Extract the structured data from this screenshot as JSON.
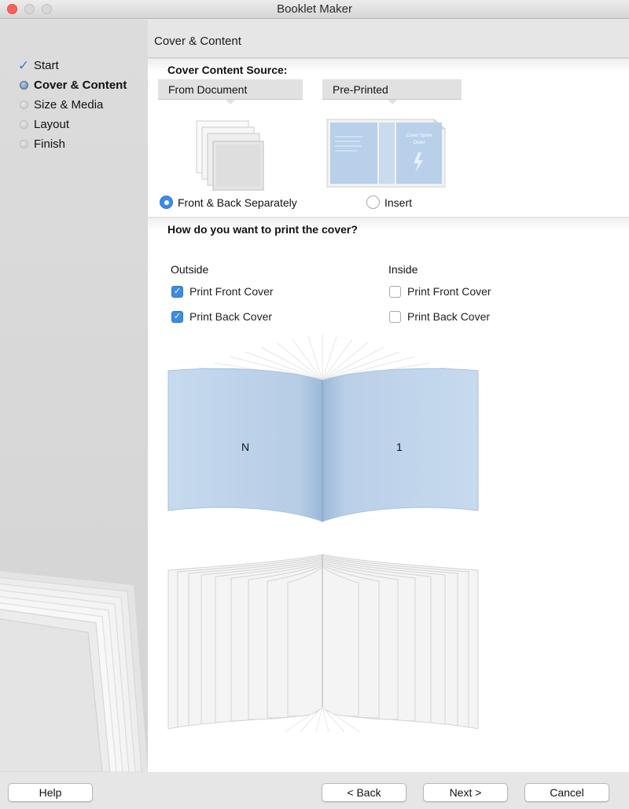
{
  "window": {
    "title": "Booklet Maker"
  },
  "sidebar": {
    "steps": [
      {
        "label": "Start",
        "state": "done"
      },
      {
        "label": "Cover & Content",
        "state": "current"
      },
      {
        "label": "Size & Media",
        "state": "pending"
      },
      {
        "label": "Layout",
        "state": "pending"
      },
      {
        "label": "Finish",
        "state": "pending"
      }
    ]
  },
  "header": {
    "title": "Cover & Content"
  },
  "cover_source": {
    "heading": "Cover Content Source:",
    "tabs": [
      "From Document",
      "Pre-Printed"
    ],
    "options": [
      {
        "label": "Front & Back Separately",
        "selected": true
      },
      {
        "label": "Insert",
        "selected": false
      }
    ],
    "preprinted_art_text": [
      "Cover Spine",
      "Outer"
    ]
  },
  "print_cover": {
    "heading": "How do you want to print the cover?",
    "outside": {
      "heading": "Outside",
      "options": [
        {
          "label": "Print Front Cover",
          "checked": true
        },
        {
          "label": "Print Back Cover",
          "checked": true
        }
      ]
    },
    "inside": {
      "heading": "Inside",
      "options": [
        {
          "label": "Print Front Cover",
          "checked": false
        },
        {
          "label": "Print Back Cover",
          "checked": false
        }
      ]
    }
  },
  "preview": {
    "left_page": "N",
    "right_page": "1"
  },
  "footer": {
    "help": "Help",
    "back": "< Back",
    "next": "Next >",
    "cancel": "Cancel"
  },
  "colors": {
    "accent": "#3c8ce7",
    "cover_blue": "#b8d0ea"
  }
}
